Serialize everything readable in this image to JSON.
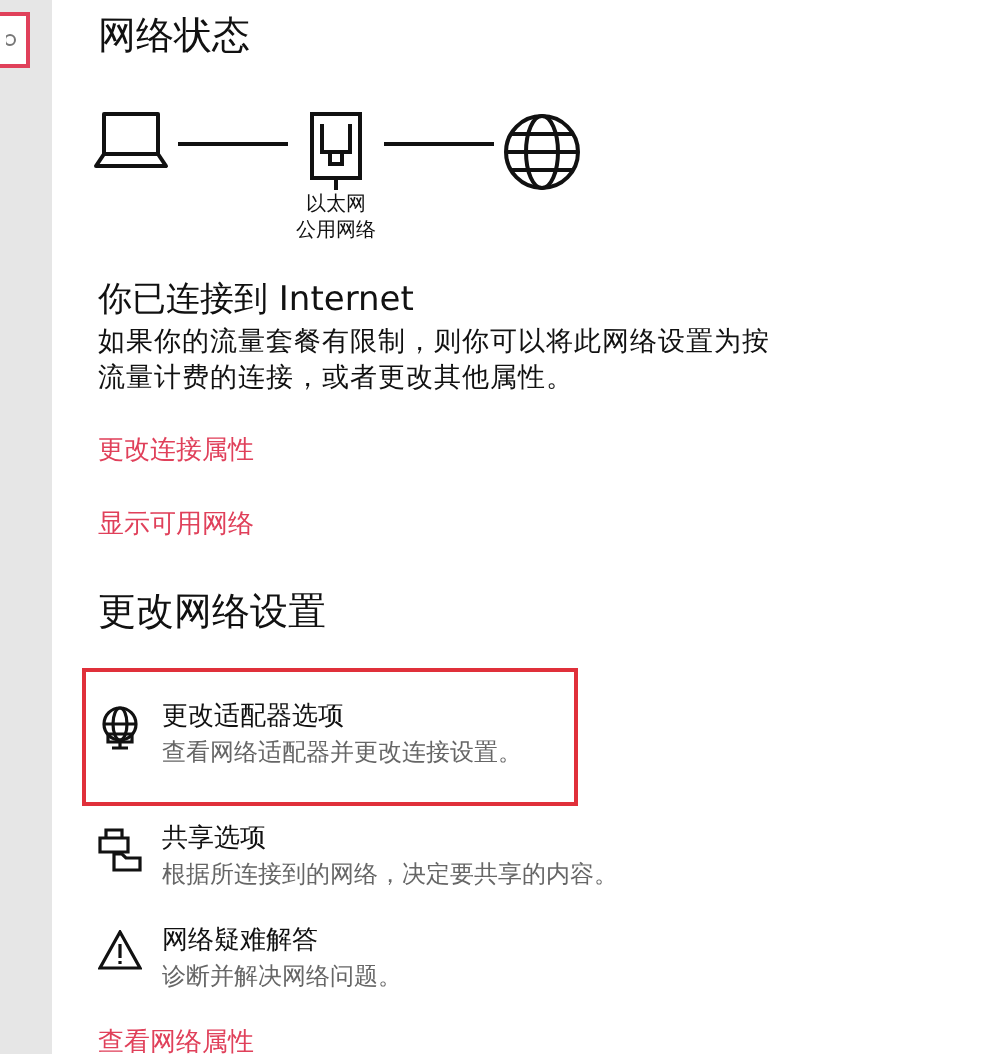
{
  "status": {
    "title": "网络状态",
    "adapter_name": "以太网",
    "network_type": "公用网络"
  },
  "connection": {
    "heading": "你已连接到 Internet",
    "description": "如果你的流量套餐有限制，则你可以将此网络设置为按流量计费的连接，或者更改其他属性。",
    "links": [
      "更改连接属性",
      "显示可用网络"
    ]
  },
  "settings": {
    "heading": "更改网络设置",
    "options": [
      {
        "kind": "adapter",
        "title": "更改适配器选项",
        "description": "查看网络适配器并更改连接设置。",
        "highlighted": true
      },
      {
        "kind": "sharing",
        "title": "共享选项",
        "description": "根据所连接到的网络，决定要共享的内容。",
        "highlighted": false
      },
      {
        "kind": "troubleshoot",
        "title": "网络疑难解答",
        "description": "诊断并解决网络问题。",
        "highlighted": false
      }
    ],
    "link": "查看网络属性"
  }
}
